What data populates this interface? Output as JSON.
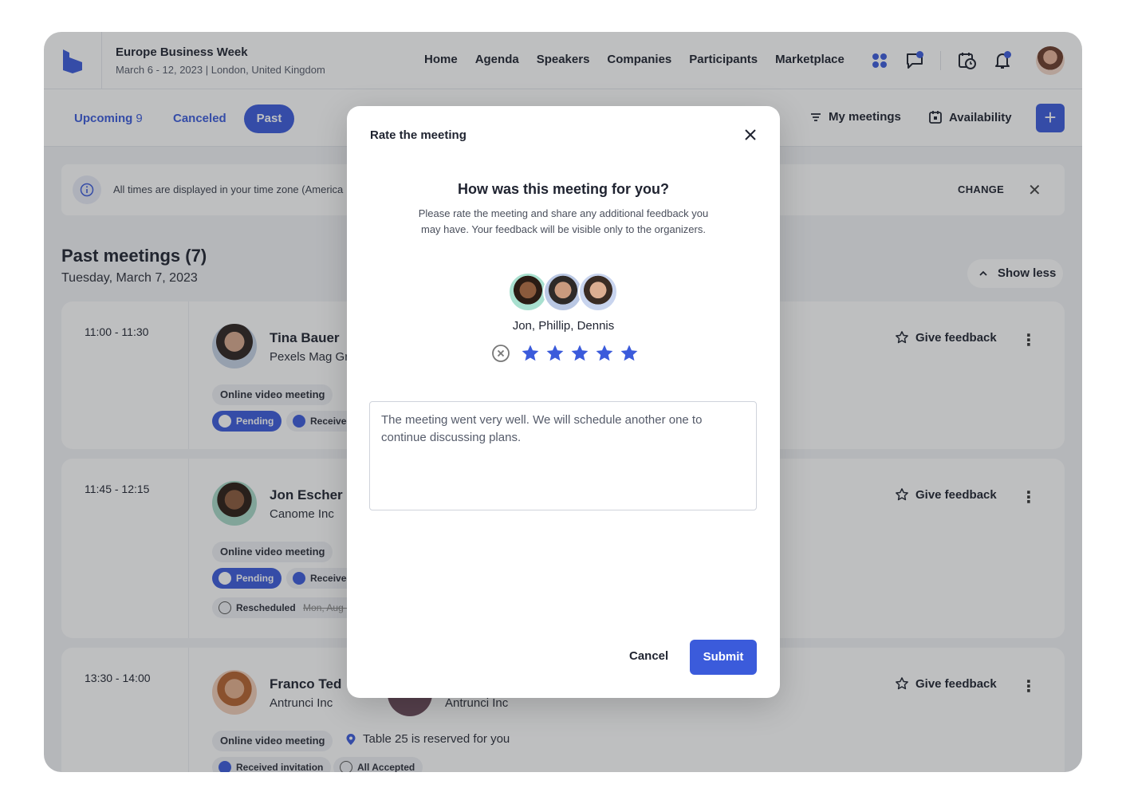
{
  "header": {
    "event_title": "Europe Business Week",
    "event_subtitle": "March 6 - 12, 2023 | London, United Kingdom",
    "nav": [
      "Home",
      "Agenda",
      "Speakers",
      "Companies",
      "Participants",
      "Marketplace"
    ],
    "icons": [
      "apps-grid-icon",
      "chat-icon",
      "calendar-clock-icon",
      "bell-icon"
    ],
    "accent_color": "#3b5bdb"
  },
  "tabs": {
    "upcoming_label": "Upcoming",
    "upcoming_count": "9",
    "canceled_label": "Canceled",
    "past_label": "Past",
    "my_meetings_label": "My meetings",
    "availability_label": "Availability",
    "add_label": "+"
  },
  "timezone_bar": {
    "text": "All times are displayed in your time zone (America",
    "change_label": "CHANGE"
  },
  "section": {
    "title": "Past meetings (7)",
    "date": "Tuesday, March 7, 2023",
    "show_less_label": "Show less"
  },
  "meetings": [
    {
      "time": "11:00 - 11:30",
      "name": "Tina Bauer",
      "company": "Pexels Mag Gr",
      "type_chip": "Online video meeting",
      "status_chip": "Pending",
      "invite_chip": "Received",
      "feedback_label": "Give feedback"
    },
    {
      "time": "11:45 - 12:15",
      "name": "Jon Escher",
      "company": "Canome Inc",
      "type_chip": "Online video meeting",
      "status_chip": "Pending",
      "invite_chip": "Received",
      "rescheduled_label": "Rescheduled",
      "rescheduled_date": "Mon, Aug 15",
      "feedback_label": "Give feedback"
    },
    {
      "time": "13:30 - 14:00",
      "name": "Franco Ted",
      "company": "Antrunci Inc",
      "other_company": "Antrunci Inc",
      "type_chip": "Online video meeting",
      "table_text": "Table 25 is reserved for you",
      "invite_chip": "Received invitation",
      "accepted_chip": "All Accepted",
      "feedback_label": "Give feedback"
    }
  ],
  "modal": {
    "title": "Rate the meeting",
    "question": "How was this meeting for you?",
    "description": "Please rate the meeting and share any additional feedback you may have. Your feedback will be visible only to the organizers.",
    "participants": "Jon, Phillip, Dennis",
    "rating": 5,
    "rating_max": 5,
    "feedback_text": "The meeting went very well. We will schedule another one to continue discussing plans.",
    "cancel_label": "Cancel",
    "submit_label": "Submit"
  }
}
